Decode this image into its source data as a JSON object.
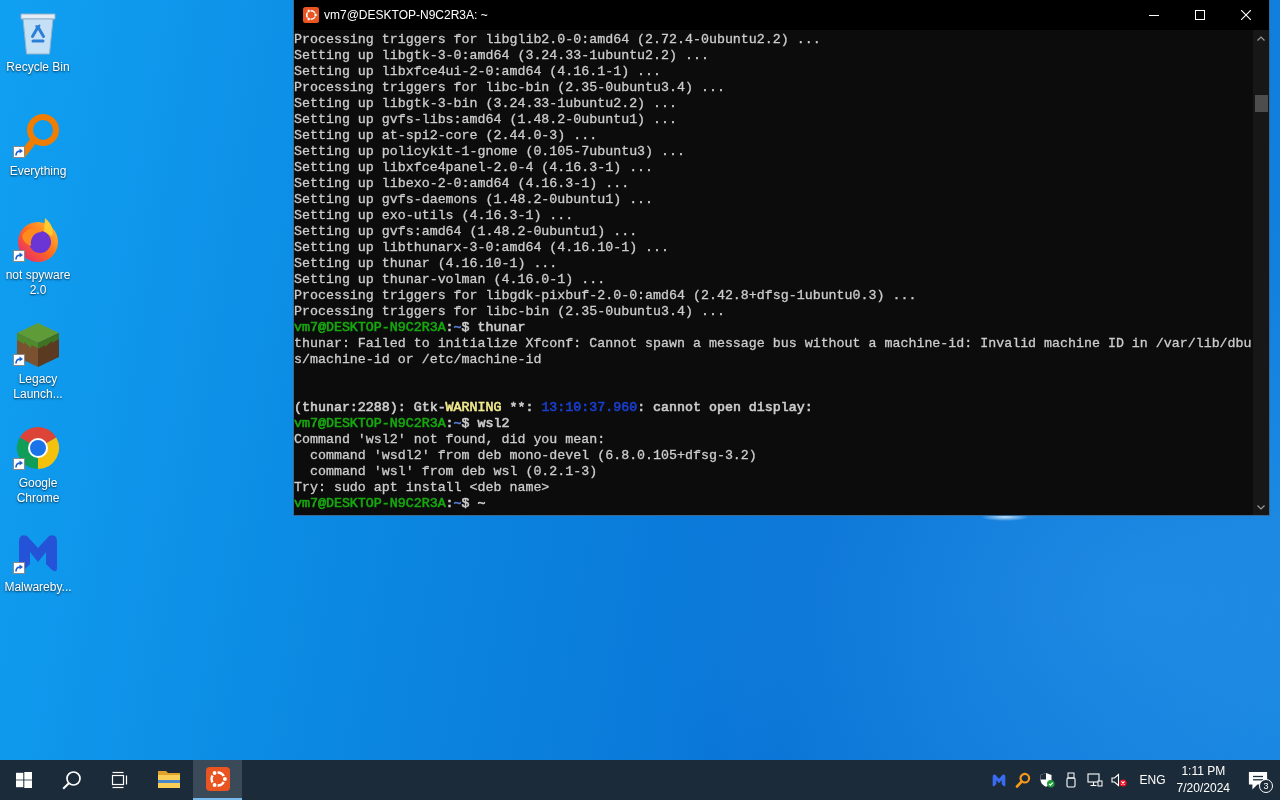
{
  "desktop": {
    "icons": [
      {
        "label": "Recycle Bin",
        "kind": "bin",
        "shortcut": false
      },
      {
        "label": "Everything",
        "kind": "magnifier",
        "shortcut": true
      },
      {
        "label": "not spyware 2.0",
        "kind": "fox",
        "shortcut": true
      },
      {
        "label": "Legacy Launch...",
        "kind": "block",
        "shortcut": true
      },
      {
        "label": "Google Chrome",
        "kind": "orb",
        "shortcut": true
      },
      {
        "label": "Malwareby...",
        "kind": "m",
        "shortcut": true
      }
    ]
  },
  "terminal": {
    "title": "vm7@DESKTOP-N9C2R3A: ~",
    "lines": [
      {
        "kind": "output",
        "text": "Processing triggers for libglib2.0-0:amd64 (2.72.4-0ubuntu2.2) ..."
      },
      {
        "kind": "output",
        "text": "Setting up libgtk-3-0:amd64 (3.24.33-1ubuntu2.2) ..."
      },
      {
        "kind": "output",
        "text": "Setting up libxfce4ui-2-0:amd64 (4.16.1-1) ..."
      },
      {
        "kind": "output",
        "text": "Processing triggers for libc-bin (2.35-0ubuntu3.4) ..."
      },
      {
        "kind": "output",
        "text": "Setting up libgtk-3-bin (3.24.33-1ubuntu2.2) ..."
      },
      {
        "kind": "output",
        "text": "Setting up gvfs-libs:amd64 (1.48.2-0ubuntu1) ..."
      },
      {
        "kind": "output",
        "text": "Setting up at-spi2-core (2.44.0-3) ..."
      },
      {
        "kind": "output",
        "text": "Setting up policykit-1-gnome (0.105-7ubuntu3) ..."
      },
      {
        "kind": "output",
        "text": "Setting up libxfce4panel-2.0-4 (4.16.3-1) ..."
      },
      {
        "kind": "output",
        "text": "Setting up libexo-2-0:amd64 (4.16.3-1) ..."
      },
      {
        "kind": "output",
        "text": "Setting up gvfs-daemons (1.48.2-0ubuntu1) ..."
      },
      {
        "kind": "output",
        "text": "Setting up exo-utils (4.16.3-1) ..."
      },
      {
        "kind": "output",
        "text": "Setting up gvfs:amd64 (1.48.2-0ubuntu1) ..."
      },
      {
        "kind": "output",
        "text": "Setting up libthunarx-3-0:amd64 (4.16.10-1) ..."
      },
      {
        "kind": "output",
        "text": "Setting up thunar (4.16.10-1) ..."
      },
      {
        "kind": "output",
        "text": "Setting up thunar-volman (4.16.0-1) ..."
      },
      {
        "kind": "output",
        "text": "Processing triggers for libgdk-pixbuf-2.0-0:amd64 (2.42.8+dfsg-1ubuntu0.3) ..."
      },
      {
        "kind": "output",
        "text": "Processing triggers for libc-bin (2.35-0ubuntu3.4) ..."
      },
      {
        "kind": "styled",
        "parts": [
          {
            "text": "vm7@DESKTOP-N9C2R3A",
            "color": "#16a80e"
          },
          {
            "text": ":",
            "color": "#cccccc"
          },
          {
            "text": "~",
            "color": "#5a82d8"
          },
          {
            "text": "$ thunar",
            "color": "#cccccc"
          }
        ]
      },
      {
        "kind": "output",
        "text": "thunar: Failed to initialize Xfconf: Cannot spawn a message bus without a machine-id: Invalid machine ID in /var/lib/dbu"
      },
      {
        "kind": "output",
        "text": "s/machine-id or /etc/machine-id"
      },
      {
        "kind": "blank"
      },
      {
        "kind": "blank"
      },
      {
        "kind": "styled",
        "parts": [
          {
            "text": "(thunar:2288): Gtk-",
            "color": "#cccccc"
          },
          {
            "text": "WARNING",
            "color": "#f2eb8c"
          },
          {
            "text": " **: ",
            "color": "#cccccc"
          },
          {
            "text": "13:10:37.960",
            "color": "#1a3fd0"
          },
          {
            "text": ": cannot open display:",
            "color": "#cccccc"
          }
        ]
      },
      {
        "kind": "styled",
        "parts": [
          {
            "text": "vm7@DESKTOP-N9C2R3A",
            "color": "#16a80e"
          },
          {
            "text": ":",
            "color": "#cccccc"
          },
          {
            "text": "~",
            "color": "#5a82d8"
          },
          {
            "text": "$ wsl2",
            "color": "#cccccc"
          }
        ]
      },
      {
        "kind": "output",
        "text": "Command 'wsl2' not found, did you mean:"
      },
      {
        "kind": "output",
        "text": "  command 'wsdl2' from deb mono-devel (6.8.0.105+dfsg-3.2)"
      },
      {
        "kind": "output",
        "text": "  command 'wsl' from deb wsl (0.2.1-3)"
      },
      {
        "kind": "output",
        "text": "Try: sudo apt install <deb name>"
      },
      {
        "kind": "styled",
        "parts": [
          {
            "text": "vm7@DESKTOP-N9C2R3A",
            "color": "#16a80e"
          },
          {
            "text": ":",
            "color": "#cccccc"
          },
          {
            "text": "~",
            "color": "#5a82d8"
          },
          {
            "text": "$ ~",
            "color": "#cccccc"
          }
        ]
      }
    ]
  },
  "taskbar": {
    "apps": [
      {
        "kind": "folder",
        "selected": false
      },
      {
        "kind": "ring",
        "selected": true
      }
    ],
    "tray": {
      "volume_muted": true,
      "language": "ENG",
      "time": "1:11 PM",
      "date": "7/20/2024",
      "notifications": "3"
    }
  }
}
